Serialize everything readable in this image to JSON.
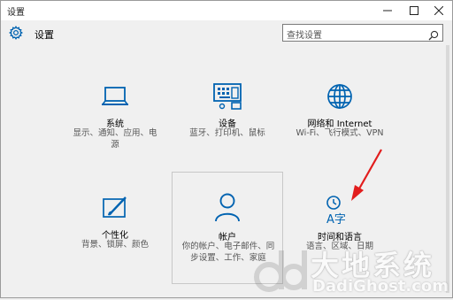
{
  "window": {
    "title": "设置"
  },
  "header": {
    "title": "设置"
  },
  "search": {
    "placeholder": "查找设置"
  },
  "accent": "#0063b1",
  "tiles": [
    {
      "title": "系统",
      "desc": "显示、通知、应用、电源",
      "icon": "laptop-icon"
    },
    {
      "title": "设备",
      "desc": "蓝牙、打印机、鼠标",
      "icon": "keyboard-printer-icon"
    },
    {
      "title": "网络和 Internet",
      "desc": "Wi-Fi、飞行模式、VPN",
      "icon": "globe-icon"
    },
    {
      "title": "个性化",
      "desc": "背景、锁屏、颜色",
      "icon": "paint-icon"
    },
    {
      "title": "帐户",
      "desc": "你的帐户、电子邮件、同步设置、工作、家庭",
      "icon": "person-icon"
    },
    {
      "title": "时间和语言",
      "desc": "语言、区域、日期",
      "icon": "time-language-icon",
      "icon_text": "A字"
    }
  ],
  "watermark": {
    "cn": "大地系统",
    "en": "DadiGhost.com"
  }
}
